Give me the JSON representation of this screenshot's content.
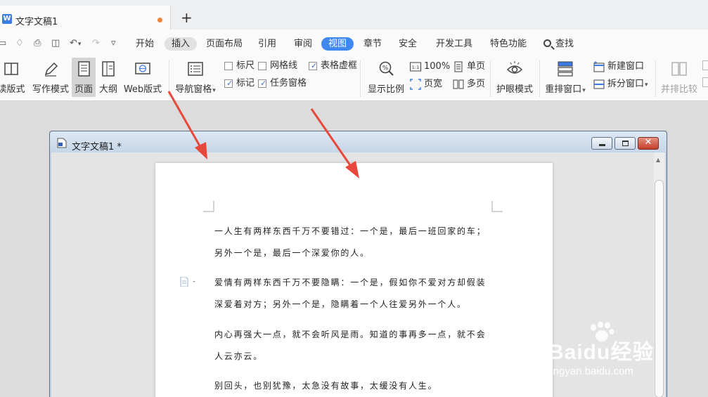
{
  "tab": {
    "title": "文字文稿1"
  },
  "menu": {
    "items": [
      "开始",
      "插入",
      "页面布局",
      "引用",
      "审阅",
      "视图",
      "章节",
      "安全",
      "开发工具",
      "特色功能"
    ],
    "search_label": "查找"
  },
  "ribbon": {
    "buttons": {
      "read_mode": "读版式",
      "write_mode": "写作模式",
      "page": "页面",
      "outline": "大纲",
      "web": "Web版式",
      "nav_pane": "导航窗格",
      "zoom": "显示比例",
      "eye_mode": "护眼模式",
      "rearrange": "重排窗口",
      "side_by_side": "并排比较"
    },
    "checkboxes": {
      "ruler": "标尺",
      "gridlines": "网格线",
      "table_gridlines": "表格虚框",
      "marks": "标记",
      "task_pane": "任务窗格"
    },
    "small_buttons": {
      "hundred": "100%",
      "page_width": "页宽",
      "single_page": "单页",
      "multi_page": "多页",
      "new_window": "新建窗口",
      "split_window": "拆分窗口"
    }
  },
  "doc_window": {
    "title": "文字文稿1 *"
  },
  "document": {
    "paragraphs": [
      "一人生有两样东西千万不要错过：一个是，最后一班回家的车；另外一个是，最后一个深爱你的人。",
      "爱情有两样东西千万不要隐瞒：一个是，假如你不爱对方却假装深爱着对方；另外一个是，隐瞒着一个人往爱另外一个人。",
      "内心再强大一点，就不会听风是雨。知道的事再多一点，就不会人云亦云。",
      "别回头，也别犹豫，太急没有故事，太缓没有人生。"
    ]
  },
  "watermark": {
    "brand": "Baidu经验",
    "url": "jingyan.baidu.com"
  },
  "colors": {
    "accent": "#3e88ef",
    "arrow": "#e8473c",
    "tab_dot": "#f0833a"
  }
}
